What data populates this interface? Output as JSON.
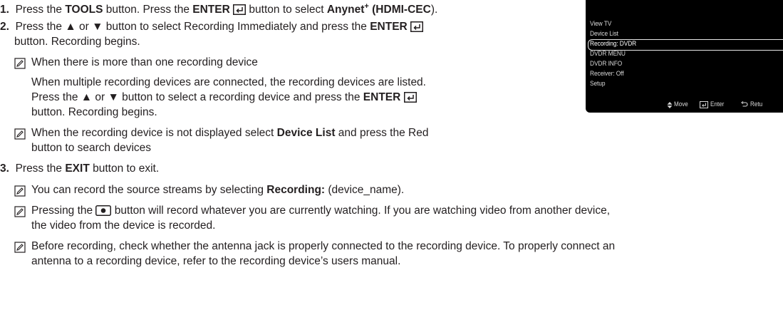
{
  "steps": [
    {
      "num": "1.",
      "t1": "Press the ",
      "b1": "TOOLS",
      "t2": " button. Press the ",
      "b2": "ENTER",
      "t3": " button to select ",
      "b3": "Anynet",
      "sup": "+",
      "b4": " (HDMI-CEC",
      "t4": ")."
    },
    {
      "num": "2.",
      "t1": "Press the ▲ or ▼ button to select Recording Immediately and press the ",
      "b1": "ENTER",
      "line2": "button. Recording begins."
    },
    {
      "num": "3.",
      "t1": "Press the ",
      "b1": "EXIT",
      "t2": " button to exit."
    }
  ],
  "notes": {
    "multi": {
      "heading": "When there is more than one recording device",
      "line1": "When multiple recording devices are connected, the recording devices are listed.",
      "line2": "Press the ▲ or ▼ button to select a recording device and press the ",
      "bold": "ENTER",
      "line3": "button. Recording begins."
    },
    "notdisplayed": {
      "t1": "When the recording device is not displayed select ",
      "bold": "Device List",
      "t2": " and press the Red",
      "line2": "button to search devices"
    },
    "source": {
      "t1": "You can record the source streams by selecting ",
      "bold": "Recording:",
      "t2": " (device_name)."
    },
    "pressing": {
      "t1": "Pressing the ",
      "t2": " button will record whatever you are currently watching. If you are watching video from another device,",
      "line2": "the video from the device is recorded."
    },
    "before": {
      "line1": "Before recording, check whether the antenna jack is properly connected to the recording device. To properly connect an",
      "line2": "antenna to a recording device, refer to the recording device’s users manual."
    }
  },
  "tv_menu": {
    "items": [
      "View TV",
      "Device List",
      "Recording: DVDR",
      "DVDR MENU",
      "DVDR INFO",
      "Receiver: Off",
      "Setup"
    ],
    "selected_index": 2,
    "footer": {
      "move": "Move",
      "enter": "Enter",
      "return": "Retu"
    }
  },
  "colors": {
    "text": "#231f20",
    "screen_bg": "#000000",
    "screen_text": "#d9d9d9"
  },
  "icons": [
    "enter-icon",
    "note-icon",
    "record-icon",
    "up-down-arrow-icon",
    "return-icon"
  ]
}
